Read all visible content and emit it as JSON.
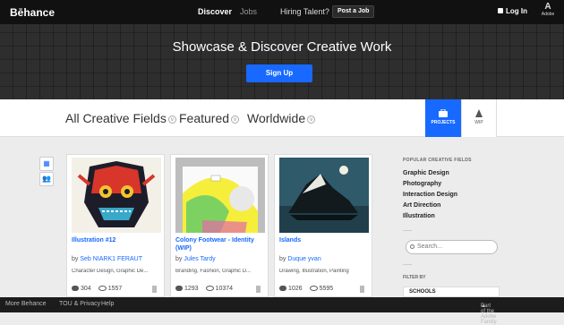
{
  "topbar": {
    "logo": "Bēhance",
    "nav_discover": "Discover",
    "nav_jobs": "Jobs",
    "nav_hiring": "Hiring Talent?",
    "post_job": "Post a Job",
    "login": "Log In",
    "adobe_mark": "A",
    "adobe_label": "Adobe"
  },
  "hero": {
    "title": "Showcase & Discover Creative Work",
    "signup": "Sign Up"
  },
  "filters": {
    "fields": "All Creative Fields",
    "sort": "Featured",
    "location": "Worldwide"
  },
  "tabs": {
    "projects": "PROJECTS",
    "wip": "WIP"
  },
  "view_icons": {
    "grid": "grid-icon",
    "list": "users-icon"
  },
  "projects": [
    {
      "title": "Illustration #12",
      "by_label": "by",
      "author": "Seb NIARK1 FERAUT",
      "fields": "Character Design, Graphic De...",
      "appreciations": "304",
      "views": "1557"
    },
    {
      "title": "Colony Footwear - Identity (WIP)",
      "by_label": "by",
      "author": "Jules Tardy",
      "fields": "Branding, Fashion, Graphic D...",
      "appreciations": "1293",
      "views": "10374"
    },
    {
      "title": "Islands",
      "by_label": "by",
      "author": "Duque yvan",
      "fields": "Drawing, Illustration, Painting",
      "appreciations": "1026",
      "views": "5595"
    }
  ],
  "sidebar": {
    "heading": "POPULAR CREATIVE FIELDS",
    "items": [
      "Graphic Design",
      "Photography",
      "Interaction Design",
      "Art Direction",
      "Illustration"
    ],
    "search_placeholder": "Search...",
    "filter_by": "FILTER BY",
    "schools": "SCHOOLS"
  },
  "footer": {
    "more": "More Behance",
    "tou": "TOU & Privacy",
    "help": "Help",
    "adobe_family": "Part of the Adobe Family"
  },
  "colors": {
    "accent": "#1769ff",
    "topbar": "#111111"
  }
}
